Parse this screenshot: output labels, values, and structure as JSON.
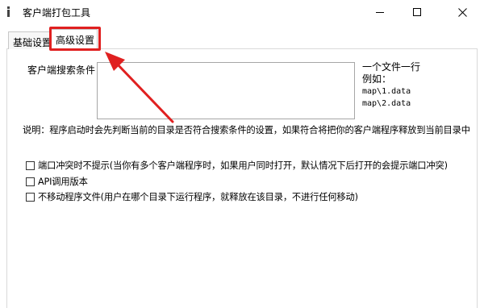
{
  "window": {
    "title": "客户端打包工具",
    "app_icon": "info-icon"
  },
  "tabs": [
    {
      "label": "基础设置",
      "active": false
    },
    {
      "label": "高级设置",
      "active": true
    }
  ],
  "search": {
    "label": "客户端搜索条件：",
    "value": ""
  },
  "hint": {
    "line1": "一个文件一行",
    "line2": "例如：",
    "example1": "map\\1.data",
    "example2": "map\\2.data"
  },
  "note": "说明：程序启动时会先判断当前的目录是否符合搜索条件的设置，如果符合将把你的客户端程序释放到当前目录中",
  "options": [
    {
      "label": "端口冲突时不提示(当你有多个客户端程序时，如果用户同时打开，默认情况下后打开的会提示端口冲突)",
      "checked": false
    },
    {
      "label": "API调用版本",
      "checked": false
    },
    {
      "label": "不移动程序文件(用户在哪个目录下运行程序，就释放在该目录，不进行任何移动)",
      "checked": false
    }
  ],
  "annotation": {
    "highlight_color": "#e02020"
  }
}
